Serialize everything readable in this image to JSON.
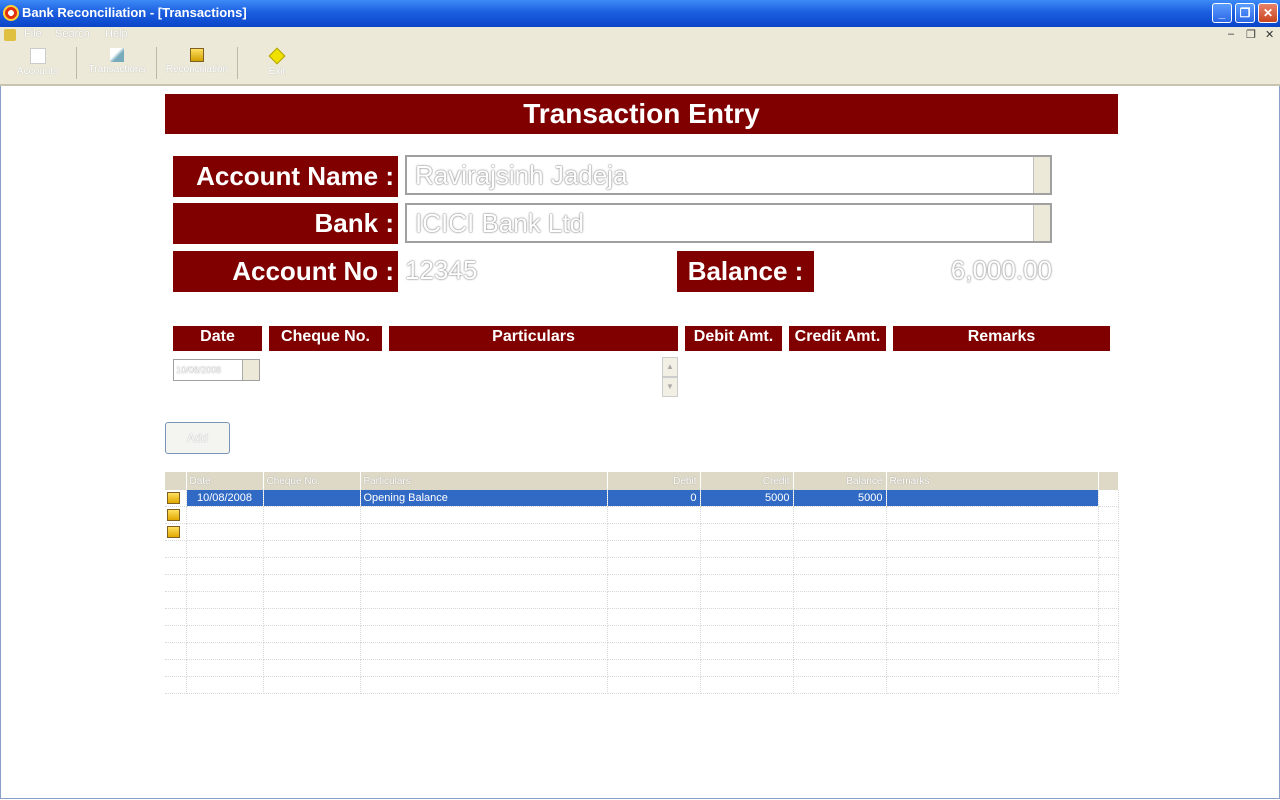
{
  "window": {
    "title": "Bank Reconciliation - [Transactions]"
  },
  "menu": [
    "File",
    "Search",
    "Help"
  ],
  "toolbar": [
    "Accounts",
    "Transactions",
    "Reconciliation",
    "Exit"
  ],
  "form": {
    "heading": "Transaction Entry",
    "account_name_label": "Account Name :",
    "account_name_value": "Ravirajsinh Jadeja",
    "bank_label": "Bank :",
    "bank_value": "ICICI Bank Ltd",
    "account_no_label": "Account No :",
    "account_no_value": "12345",
    "balance_label": "Balance :",
    "balance_value": "6,000.00"
  },
  "entry_columns": [
    "Date",
    "Cheque No.",
    "Particulars",
    "Debit Amt.",
    "Credit Amt.",
    "Remarks"
  ],
  "entry": {
    "date": "10/08/2008"
  },
  "add_button": "Add",
  "grid": {
    "columns": [
      "Date",
      "Cheque No.",
      "Particulars",
      "Debit",
      "Credit",
      "Balance",
      "Remarks"
    ],
    "rows": [
      {
        "date": "10/08/2008",
        "cheque": "",
        "particulars": "Opening Balance",
        "debit": "0",
        "credit": "5000",
        "balance": "5000",
        "remarks": ""
      }
    ]
  },
  "colors": {
    "accent": "#800000",
    "selection": "#316ac5",
    "titlebar": "#0a44c8"
  }
}
